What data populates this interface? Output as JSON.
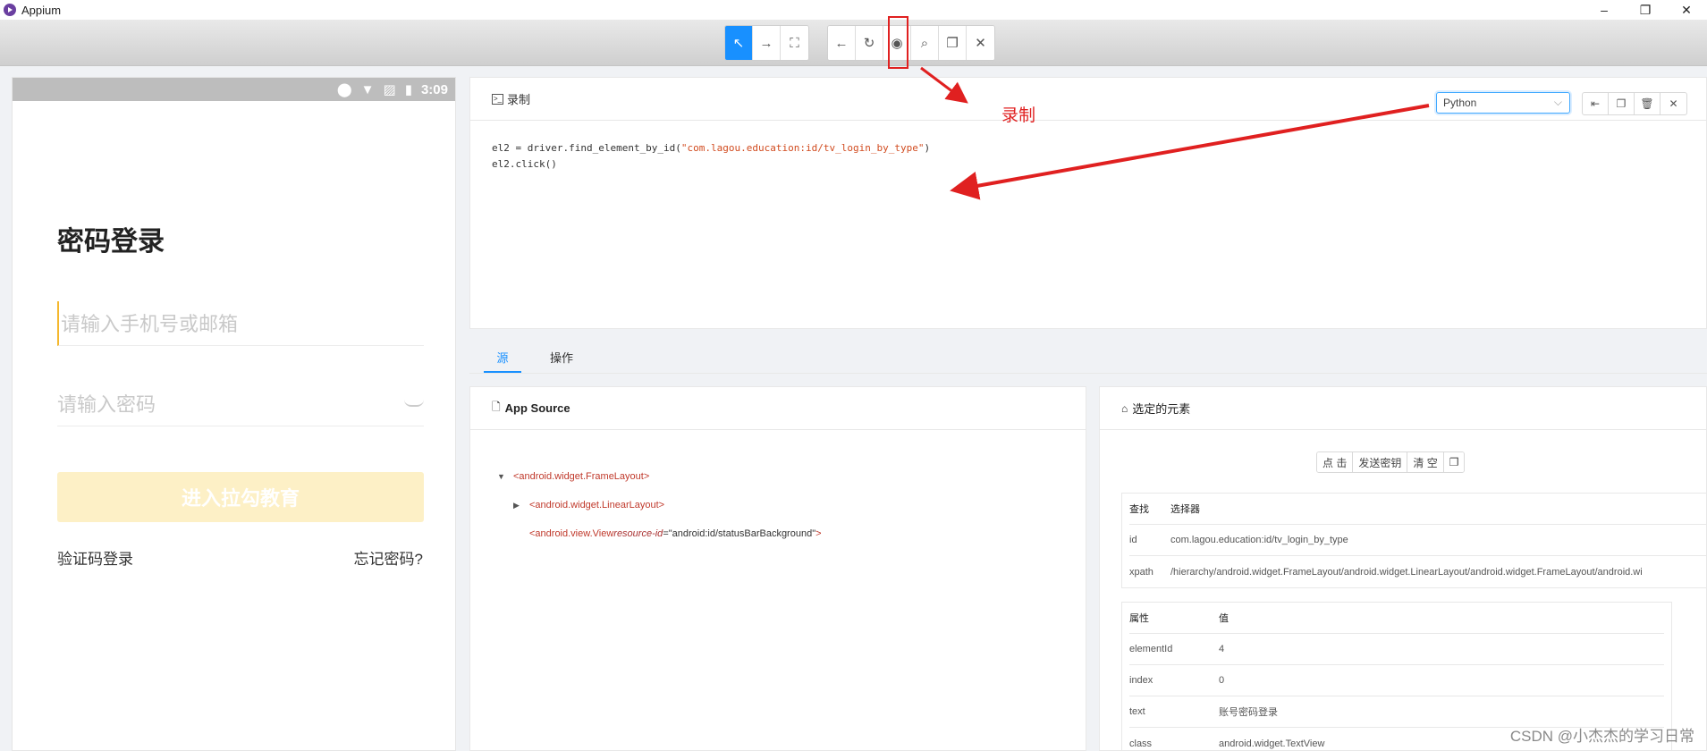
{
  "app": {
    "title": "Appium"
  },
  "window_controls": {
    "minimize": "–",
    "restore": "❐",
    "close": "✕"
  },
  "toolbar": {
    "group1": [
      {
        "name": "select-elements-button",
        "icon": "↖",
        "active": true
      },
      {
        "name": "swipe-button",
        "icon": "→"
      },
      {
        "name": "tap-coordinates-button",
        "icon": "⛶"
      }
    ],
    "group2": [
      {
        "name": "back-button",
        "icon": "←"
      },
      {
        "name": "refresh-button",
        "icon": "↻"
      },
      {
        "name": "record-button",
        "icon": "◉"
      },
      {
        "name": "search-button",
        "icon": "⌕"
      },
      {
        "name": "copy-xml-button",
        "icon": "❐"
      },
      {
        "name": "quit-session-button",
        "icon": "✕"
      }
    ]
  },
  "device": {
    "status_time": "3:09",
    "status_icons": [
      "⬤",
      "▼",
      "▨",
      "▮"
    ],
    "login_title": "密码登录",
    "phone_placeholder": "请输入手机号或邮箱",
    "password_placeholder": "请输入密码",
    "login_button": "进入拉勾教育",
    "sms_login": "验证码登录",
    "forgot_password": "忘记密码?"
  },
  "recorder": {
    "title": "录制",
    "language": "Python",
    "code_line1_prefix": "el2 = driver.find_element_by_id(",
    "code_line1_string": "\"com.lagou.education:id/tv_login_by_type\"",
    "code_line1_suffix": ")",
    "code_line2": "el2.click()",
    "actions": [
      "⇤",
      "❐",
      "🗑",
      "✕"
    ]
  },
  "annotation": {
    "label": "录制"
  },
  "tabs": [
    {
      "label": "源",
      "active": true
    },
    {
      "label": "操作",
      "active": false
    }
  ],
  "source": {
    "title": "App Source",
    "nodes": [
      {
        "caret": "▼",
        "tag": "<android.widget.FrameLayout>"
      },
      {
        "caret": "▶",
        "tag": "<android.widget.LinearLayout>"
      },
      {
        "caret": "",
        "tag_open": "<android.view.View ",
        "attr": "resource-id",
        "eq": "=",
        "value": "\"android:id/statusBarBackground\"",
        "tag_close": ">"
      }
    ]
  },
  "selected": {
    "title": "选定的元素",
    "actions": [
      "点 击",
      "发送密钥",
      "清 空",
      "❐"
    ],
    "find_header": {
      "c1": "查找",
      "c2": "选择器"
    },
    "find_rows": [
      {
        "c1": "id",
        "c2": "com.lagou.education:id/tv_login_by_type"
      },
      {
        "c1": "xpath",
        "c2": "/hierarchy/android.widget.FrameLayout/android.widget.LinearLayout/android.widget.FrameLayout/android.wi"
      }
    ],
    "attr_header": {
      "c1": "属性",
      "c2": "值"
    },
    "attr_rows": [
      {
        "c1": "elementId",
        "c2": "4"
      },
      {
        "c1": "index",
        "c2": "0"
      },
      {
        "c1": "text",
        "c2": "账号密码登录"
      },
      {
        "c1": "class",
        "c2": "android.widget.TextView"
      }
    ]
  },
  "watermark": "CSDN @小杰杰的学习日常",
  "colors": {
    "accent": "#1890ff",
    "annotation_red": "#e02020"
  }
}
